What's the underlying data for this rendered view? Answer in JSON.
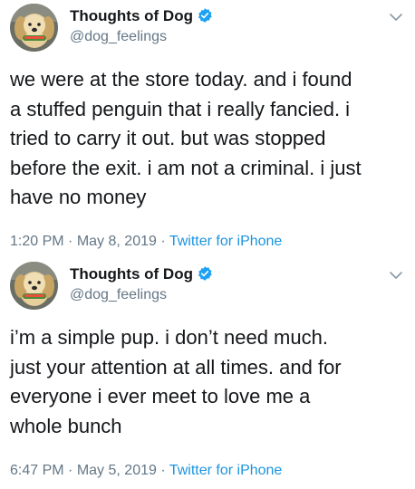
{
  "tweets": [
    {
      "author_name": "Thoughts of Dog",
      "handle": "@dog_feelings",
      "text": "we were at the store today. and i found\na stuffed penguin that i really fancied. i\ntried to carry it out. but was stopped\nbefore the exit. i am not a criminal. i just\nhave no money",
      "time": "1:20 PM",
      "date": "May 8, 2019",
      "source": "Twitter for iPhone",
      "separator": "·"
    },
    {
      "author_name": "Thoughts of Dog",
      "handle": "@dog_feelings",
      "text": "i’m a simple pup. i don’t need much.\njust your attention at all times. and for\neveryone i ever meet to love me a\nwhole bunch",
      "time": "6:47 PM",
      "date": "May 5, 2019",
      "source": "Twitter for iPhone",
      "separator": "·"
    }
  ],
  "icons": {
    "verified": "verified-badge-icon",
    "menu": "chevron-down-icon",
    "avatar": "dog-avatar"
  },
  "colors": {
    "text": "#14171a",
    "secondary": "#657786",
    "link": "#1b95e0",
    "verified": "#1da1f2"
  }
}
